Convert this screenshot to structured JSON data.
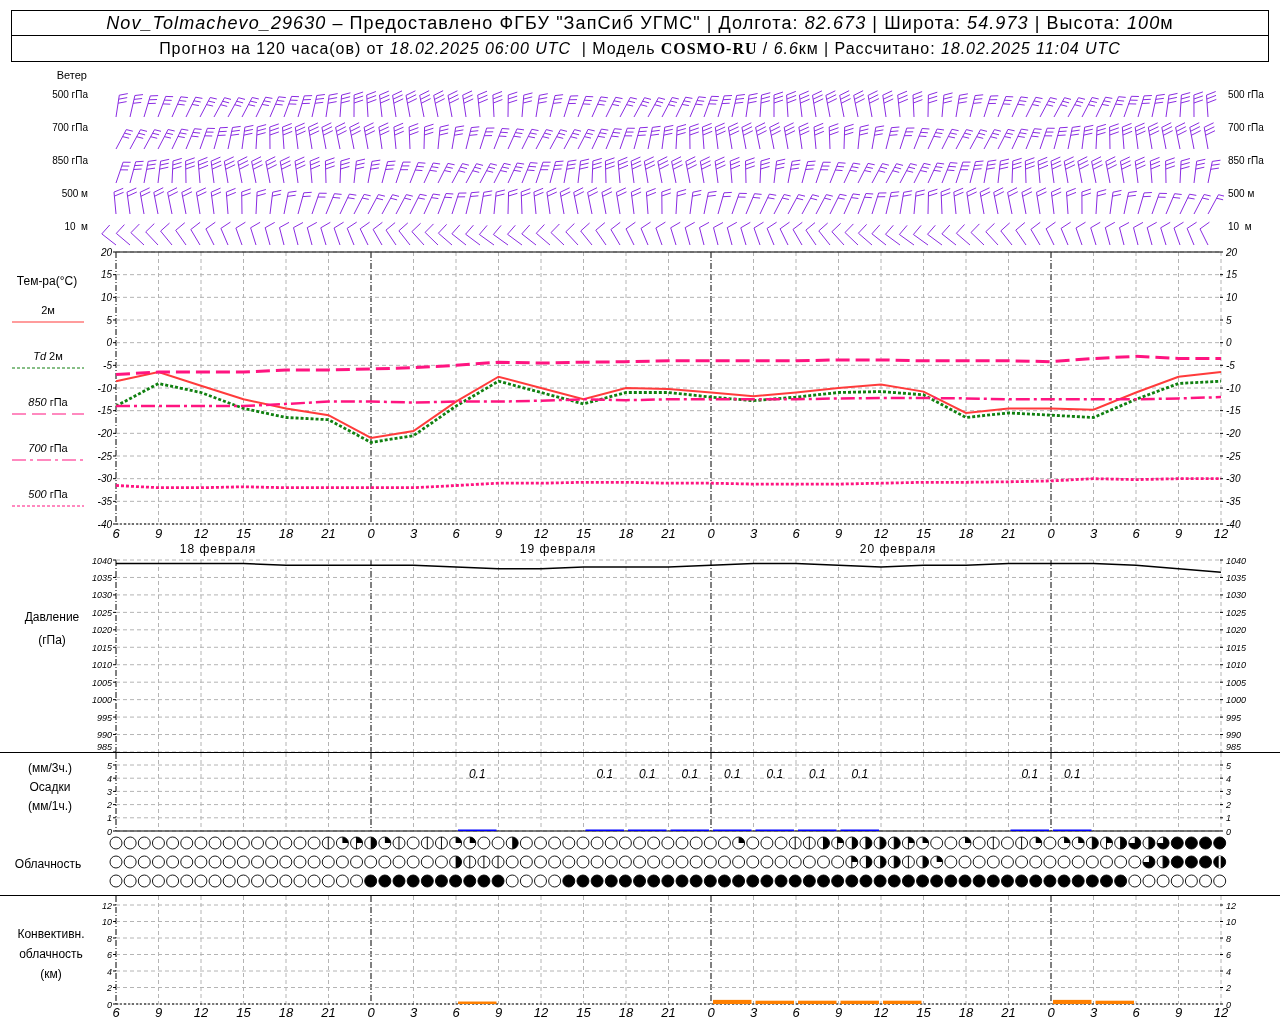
{
  "header": {
    "line1": [
      {
        "text": "Nov_Tolmachevo_29630",
        "kind": "italic"
      },
      {
        "text": " – Предоставлено ФГБУ \"ЗапСиб УГМС\" | Долгота: ",
        "kind": "plain"
      },
      {
        "text": "82.673",
        "kind": "italic"
      },
      {
        "text": " | Широта: ",
        "kind": "plain"
      },
      {
        "text": "54.973",
        "kind": "italic"
      },
      {
        "text": " | Высота: ",
        "kind": "plain"
      },
      {
        "text": "100",
        "kind": "italic"
      },
      {
        "text": "м",
        "kind": "plain"
      }
    ],
    "line2": [
      {
        "text": "Прогноз на 120 часа(ов) от ",
        "kind": "plain"
      },
      {
        "text": "18.02.2025 06:00 UTC",
        "kind": "italic"
      },
      {
        "text": "  | Модель ",
        "kind": "plain"
      },
      {
        "text": "COSMO-RU",
        "kind": "bold"
      },
      {
        "text": " / ",
        "kind": "plain"
      },
      {
        "text": "6.6",
        "kind": "italic"
      },
      {
        "text": "км | Рассчитано: ",
        "kind": "plain"
      },
      {
        "text": "18.02.2025 11:04 UTC",
        "kind": "italic"
      }
    ]
  },
  "wind": {
    "title": "Ветер",
    "levels": [
      {
        "left": "500 гПа",
        "right": "500 гПа"
      },
      {
        "left": "700 гПа",
        "right": "700 гПа"
      },
      {
        "left": "850 гПа",
        "right": "850 гПа"
      },
      {
        "left": "500 м",
        "right": "500 м"
      },
      {
        "left": "10  м",
        "right": "10  м"
      }
    ]
  },
  "temperature": {
    "right_yticks": [
      "20",
      "15",
      "10",
      "5",
      "0",
      "-5",
      "-10",
      "-15",
      "-20",
      "-25",
      "-30",
      "-35",
      "-40"
    ],
    "dates": [
      "18 февраля",
      "19 февраля",
      "20 февраля"
    ],
    "chart_data": {
      "type": "line",
      "grid": true,
      "ylabel": "Тем-ра(°C)",
      "ylim": [
        -40,
        20
      ],
      "yticks": [
        20,
        15,
        10,
        5,
        0,
        -5,
        -10,
        -15,
        -20,
        -25,
        -30,
        -35,
        -40
      ],
      "categories": [
        "6",
        "9",
        "12",
        "15",
        "18",
        "21",
        "0",
        "3",
        "6",
        "9",
        "12",
        "15",
        "18",
        "21",
        "0",
        "3",
        "6",
        "9",
        "12",
        "15",
        "18",
        "21",
        "0",
        "3",
        "6",
        "9",
        "12"
      ],
      "series": [
        {
          "name": "2м",
          "line_style": "solid",
          "color": "#ff3b3b",
          "values": [
            -8.5,
            -6.5,
            -9.5,
            -12.5,
            -14.5,
            -16,
            -21,
            -19.5,
            -13,
            -7.5,
            -10,
            -12.5,
            -10,
            -10.2,
            -11,
            -11.8,
            -11,
            -10,
            -9.2,
            -10.8,
            -15.5,
            -14.5,
            -14.5,
            -14.8,
            -11,
            -7.5,
            -6.5
          ]
        },
        {
          "name": "*Td* 2м",
          "line_style": "dotted",
          "color": "#108010",
          "values": [
            -14,
            -9,
            -11,
            -14.5,
            -16.5,
            -17,
            -22,
            -20.5,
            -14,
            -8.5,
            -11,
            -13.5,
            -11,
            -11,
            -12,
            -12.8,
            -12,
            -11,
            -10.8,
            -11.5,
            -16.5,
            -15.5,
            -16,
            -16.5,
            -12.5,
            -9,
            -8.5
          ]
        },
        {
          "name": "*850* гПа",
          "line_style": "dashed",
          "color": "#ff1480",
          "values": [
            -7,
            -6.5,
            -6.5,
            -6.5,
            -6,
            -6,
            -5.8,
            -5.5,
            -5,
            -4.3,
            -4.5,
            -4.3,
            -4.2,
            -4,
            -4,
            -4,
            -4,
            -3.8,
            -3.8,
            -4,
            -4,
            -4,
            -4.2,
            -3.5,
            -3,
            -3.5,
            -3.5
          ]
        },
        {
          "name": "*700* гПа",
          "line_style": "dashdot",
          "color": "#ff1480",
          "values": [
            -14,
            -14,
            -14,
            -14,
            -13.5,
            -13,
            -13,
            -13.2,
            -13,
            -13,
            -12.8,
            -12.5,
            -12.7,
            -12.5,
            -12.5,
            -12.5,
            -12.5,
            -12.3,
            -12.2,
            -12.2,
            -12.3,
            -12.5,
            -12.5,
            -12.5,
            -12.5,
            -12.3,
            -12
          ]
        },
        {
          "name": "*500* гПа",
          "line_style": "dotted",
          "color": "#ff1480",
          "values": [
            -31.5,
            -32,
            -32,
            -31.8,
            -32,
            -32,
            -32,
            -32,
            -31.5,
            -31,
            -31,
            -30.8,
            -30.8,
            -31,
            -31,
            -31.2,
            -31.2,
            -31.2,
            -31,
            -30.8,
            -30.8,
            -30.7,
            -30.5,
            -30,
            -30.2,
            -30,
            -30
          ]
        }
      ]
    }
  },
  "pressure": {
    "right_yticks": [
      "1040",
      "1035",
      "1030",
      "1025",
      "1020",
      "1015",
      "1010",
      "1005",
      "1000",
      "995",
      "990",
      "985"
    ],
    "chart_data": {
      "type": "line",
      "grid": true,
      "ylabel": "Давление (гПа)",
      "ylim": [
        985,
        1040
      ],
      "yticks": [
        1040,
        1035,
        1030,
        1025,
        1020,
        1015,
        1010,
        1005,
        1000,
        995,
        990,
        985
      ],
      "series": [
        {
          "color": "#000000",
          "values": [
            1039,
            1039,
            1039,
            1039,
            1038.5,
            1038.5,
            1038.5,
            1038.5,
            1038,
            1037.5,
            1037.5,
            1038,
            1038,
            1038,
            1038.5,
            1039,
            1039,
            1038.5,
            1038,
            1038.5,
            1038.5,
            1039,
            1039,
            1039,
            1038.5,
            1037.5,
            1036.5
          ]
        }
      ]
    }
  },
  "precipitation": {
    "right_yticks": [
      "5",
      "4",
      "3",
      "2",
      "1",
      "0"
    ],
    "chart_data": {
      "type": "bar",
      "ylabel": "(мм/3ч.) Осадки (мм/1ч.)",
      "ylim": [
        0,
        5
      ],
      "yticks": [
        5,
        4,
        3,
        2,
        1,
        0
      ],
      "grid": true,
      "value_labels": [
        null,
        null,
        null,
        null,
        null,
        null,
        null,
        null,
        "0.1",
        null,
        null,
        "0.1",
        "0.1",
        "0.1",
        "0.1",
        "0.1",
        "0.1",
        "0.1",
        null,
        null,
        null,
        "0.1",
        "0.1",
        null,
        null,
        null
      ],
      "series": [
        {
          "color": "#0000ff",
          "values": [
            0,
            0,
            0,
            0,
            0,
            0,
            0,
            0,
            0.1,
            0,
            0,
            0.1,
            0.1,
            0.1,
            0.1,
            0.1,
            0.1,
            0.1,
            0,
            0,
            0,
            0.1,
            0.1,
            0,
            0,
            0
          ]
        }
      ]
    }
  },
  "clouds": {
    "label": "Облачность",
    "rows": [
      {
        "cells": [
          {
            "kind": "clear"
          },
          {
            "kind": "clear"
          },
          {
            "kind": "clear"
          },
          {
            "kind": "clear"
          },
          {
            "kind": "clear"
          },
          {
            "kind": "clear"
          },
          {
            "kind": "clear"
          },
          {
            "kind": "clear"
          },
          {
            "kind": "clear"
          },
          {
            "kind": "clear"
          },
          {
            "kind": "clear"
          },
          {
            "kind": "clear"
          },
          {
            "kind": "clear"
          },
          {
            "kind": "clear"
          },
          {
            "kind": "clear"
          },
          {
            "kind": "one"
          },
          {
            "kind": "two"
          },
          {
            "kind": "three"
          },
          {
            "kind": "four"
          },
          {
            "kind": "two"
          },
          {
            "kind": "one"
          },
          {
            "kind": "clear"
          },
          {
            "kind": "one"
          },
          {
            "kind": "one"
          },
          {
            "kind": "two"
          },
          {
            "kind": "two"
          },
          {
            "kind": "clear"
          },
          {
            "kind": "clear"
          },
          {
            "kind": "four"
          },
          {
            "kind": "clear"
          },
          {
            "kind": "clear"
          },
          {
            "kind": "clear"
          },
          {
            "kind": "clear"
          },
          {
            "kind": "clear"
          },
          {
            "kind": "clear"
          },
          {
            "kind": "clear"
          },
          {
            "kind": "clear"
          },
          {
            "kind": "clear"
          },
          {
            "kind": "clear"
          },
          {
            "kind": "clear"
          },
          {
            "kind": "clear"
          },
          {
            "kind": "clear"
          },
          {
            "kind": "clear"
          },
          {
            "kind": "clear"
          },
          {
            "kind": "two"
          },
          {
            "kind": "clear"
          },
          {
            "kind": "clear"
          },
          {
            "kind": "clear"
          },
          {
            "kind": "one"
          },
          {
            "kind": "one"
          },
          {
            "kind": "five"
          },
          {
            "kind": "three"
          },
          {
            "kind": "four"
          },
          {
            "kind": "five"
          },
          {
            "kind": "five"
          },
          {
            "kind": "five"
          },
          {
            "kind": "three"
          },
          {
            "kind": "two"
          },
          {
            "kind": "clear"
          },
          {
            "kind": "clear"
          },
          {
            "kind": "two"
          },
          {
            "kind": "clear"
          },
          {
            "kind": "one"
          },
          {
            "kind": "clear"
          },
          {
            "kind": "one"
          },
          {
            "kind": "two"
          },
          {
            "kind": "clear"
          },
          {
            "kind": "two"
          },
          {
            "kind": "two"
          },
          {
            "kind": "five"
          },
          {
            "kind": "three"
          },
          {
            "kind": "five"
          },
          {
            "kind": "six"
          },
          {
            "kind": "five"
          },
          {
            "kind": "six"
          },
          {
            "kind": "overcast"
          },
          {
            "kind": "overcast"
          },
          {
            "kind": "overcast"
          },
          {
            "kind": "overcast"
          }
        ]
      },
      {
        "cells": [
          {
            "kind": "clear"
          },
          {
            "kind": "clear"
          },
          {
            "kind": "clear"
          },
          {
            "kind": "clear"
          },
          {
            "kind": "clear"
          },
          {
            "kind": "clear"
          },
          {
            "kind": "clear"
          },
          {
            "kind": "clear"
          },
          {
            "kind": "clear"
          },
          {
            "kind": "clear"
          },
          {
            "kind": "clear"
          },
          {
            "kind": "clear"
          },
          {
            "kind": "clear"
          },
          {
            "kind": "clear"
          },
          {
            "kind": "clear"
          },
          {
            "kind": "clear"
          },
          {
            "kind": "clear"
          },
          {
            "kind": "clear"
          },
          {
            "kind": "clear"
          },
          {
            "kind": "clear"
          },
          {
            "kind": "clear"
          },
          {
            "kind": "clear"
          },
          {
            "kind": "clear"
          },
          {
            "kind": "clear"
          },
          {
            "kind": "four"
          },
          {
            "kind": "one"
          },
          {
            "kind": "one"
          },
          {
            "kind": "one"
          },
          {
            "kind": "clear"
          },
          {
            "kind": "clear"
          },
          {
            "kind": "clear"
          },
          {
            "kind": "clear"
          },
          {
            "kind": "clear"
          },
          {
            "kind": "clear"
          },
          {
            "kind": "clear"
          },
          {
            "kind": "clear"
          },
          {
            "kind": "clear"
          },
          {
            "kind": "clear"
          },
          {
            "kind": "clear"
          },
          {
            "kind": "clear"
          },
          {
            "kind": "clear"
          },
          {
            "kind": "clear"
          },
          {
            "kind": "clear"
          },
          {
            "kind": "clear"
          },
          {
            "kind": "clear"
          },
          {
            "kind": "clear"
          },
          {
            "kind": "clear"
          },
          {
            "kind": "clear"
          },
          {
            "kind": "clear"
          },
          {
            "kind": "clear"
          },
          {
            "kind": "clear"
          },
          {
            "kind": "clear"
          },
          {
            "kind": "three"
          },
          {
            "kind": "four"
          },
          {
            "kind": "four"
          },
          {
            "kind": "five"
          },
          {
            "kind": "one"
          },
          {
            "kind": "four"
          },
          {
            "kind": "two"
          },
          {
            "kind": "clear"
          },
          {
            "kind": "clear"
          },
          {
            "kind": "clear"
          },
          {
            "kind": "clear"
          },
          {
            "kind": "clear"
          },
          {
            "kind": "clear"
          },
          {
            "kind": "clear"
          },
          {
            "kind": "clear"
          },
          {
            "kind": "clear"
          },
          {
            "kind": "clear"
          },
          {
            "kind": "clear"
          },
          {
            "kind": "clear"
          },
          {
            "kind": "clear"
          },
          {
            "kind": "clear"
          },
          {
            "kind": "six"
          },
          {
            "kind": "five"
          },
          {
            "kind": "overcast"
          },
          {
            "kind": "overcast"
          },
          {
            "kind": "overcast"
          },
          {
            "kind": "seven"
          }
        ]
      },
      {
        "cells": [
          {
            "kind": "clear"
          },
          {
            "kind": "clear"
          },
          {
            "kind": "clear"
          },
          {
            "kind": "clear"
          },
          {
            "kind": "clear"
          },
          {
            "kind": "clear"
          },
          {
            "kind": "clear"
          },
          {
            "kind": "clear"
          },
          {
            "kind": "clear"
          },
          {
            "kind": "clear"
          },
          {
            "kind": "clear"
          },
          {
            "kind": "clear"
          },
          {
            "kind": "clear"
          },
          {
            "kind": "clear"
          },
          {
            "kind": "clear"
          },
          {
            "kind": "clear"
          },
          {
            "kind": "clear"
          },
          {
            "kind": "clear"
          },
          {
            "kind": "overcast"
          },
          {
            "kind": "overcast"
          },
          {
            "kind": "overcast"
          },
          {
            "kind": "overcast"
          },
          {
            "kind": "overcast"
          },
          {
            "kind": "overcast"
          },
          {
            "kind": "overcast"
          },
          {
            "kind": "overcast"
          },
          {
            "kind": "overcast"
          },
          {
            "kind": "overcast"
          },
          {
            "kind": "clear"
          },
          {
            "kind": "clear"
          },
          {
            "kind": "clear"
          },
          {
            "kind": "clear"
          },
          {
            "kind": "overcast"
          },
          {
            "kind": "overcast"
          },
          {
            "kind": "overcast"
          },
          {
            "kind": "overcast"
          },
          {
            "kind": "overcast"
          },
          {
            "kind": "overcast"
          },
          {
            "kind": "overcast"
          },
          {
            "kind": "overcast"
          },
          {
            "kind": "overcast"
          },
          {
            "kind": "overcast"
          },
          {
            "kind": "overcast"
          },
          {
            "kind": "overcast"
          },
          {
            "kind": "overcast"
          },
          {
            "kind": "overcast"
          },
          {
            "kind": "overcast"
          },
          {
            "kind": "overcast"
          },
          {
            "kind": "overcast"
          },
          {
            "kind": "overcast"
          },
          {
            "kind": "overcast"
          },
          {
            "kind": "overcast"
          },
          {
            "kind": "overcast"
          },
          {
            "kind": "overcast"
          },
          {
            "kind": "overcast"
          },
          {
            "kind": "overcast"
          },
          {
            "kind": "overcast"
          },
          {
            "kind": "overcast"
          },
          {
            "kind": "overcast"
          },
          {
            "kind": "overcast"
          },
          {
            "kind": "overcast"
          },
          {
            "kind": "overcast"
          },
          {
            "kind": "overcast"
          },
          {
            "kind": "overcast"
          },
          {
            "kind": "overcast"
          },
          {
            "kind": "overcast"
          },
          {
            "kind": "overcast"
          },
          {
            "kind": "overcast"
          },
          {
            "kind": "overcast"
          },
          {
            "kind": "overcast"
          },
          {
            "kind": "overcast"
          },
          {
            "kind": "overcast"
          },
          {
            "kind": "clear"
          },
          {
            "kind": "clear"
          },
          {
            "kind": "clear"
          },
          {
            "kind": "clear"
          },
          {
            "kind": "clear"
          },
          {
            "kind": "clear"
          },
          {
            "kind": "clear"
          }
        ]
      }
    ]
  },
  "convective": {
    "right_yticks": [
      "12",
      "10",
      "8",
      "6",
      "4",
      "2",
      "0"
    ],
    "hour_labels": [
      "6",
      "9",
      "12",
      "15",
      "18",
      "21",
      "0",
      "3",
      "6",
      "9",
      "12",
      "15",
      "18",
      "21",
      "0",
      "3",
      "6",
      "9",
      "12",
      "15",
      "18",
      "21",
      "0",
      "3",
      "6",
      "9",
      "12"
    ],
    "chart_data": {
      "type": "bar",
      "grid": true,
      "ylabel": "Конвективн. облачность (км)",
      "ylim": [
        0,
        12
      ],
      "yticks": [
        12,
        10,
        8,
        6,
        4,
        2,
        0
      ],
      "series": [
        {
          "color": "#ff8000",
          "values": [
            0,
            0,
            0,
            0,
            0,
            0,
            0,
            0,
            0.3,
            0,
            0,
            0,
            0,
            0,
            0.5,
            0.4,
            0.4,
            0.4,
            0.4,
            0,
            0,
            0,
            0.5,
            0.4,
            0,
            0
          ]
        }
      ]
    }
  }
}
